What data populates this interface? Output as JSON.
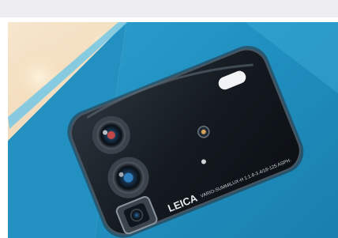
{
  "photo": {
    "brand_label": "LEICA",
    "lens_spec_text": "VARIO-SUMMILUX-H 1:1.8-3.4/18-125 ASPH.",
    "colors": {
      "phone_body": "#1f8fbf",
      "phone_body_highlight": "#46b6de",
      "camera_module": "#141a20",
      "background_warm": "#f1d9b8"
    }
  }
}
